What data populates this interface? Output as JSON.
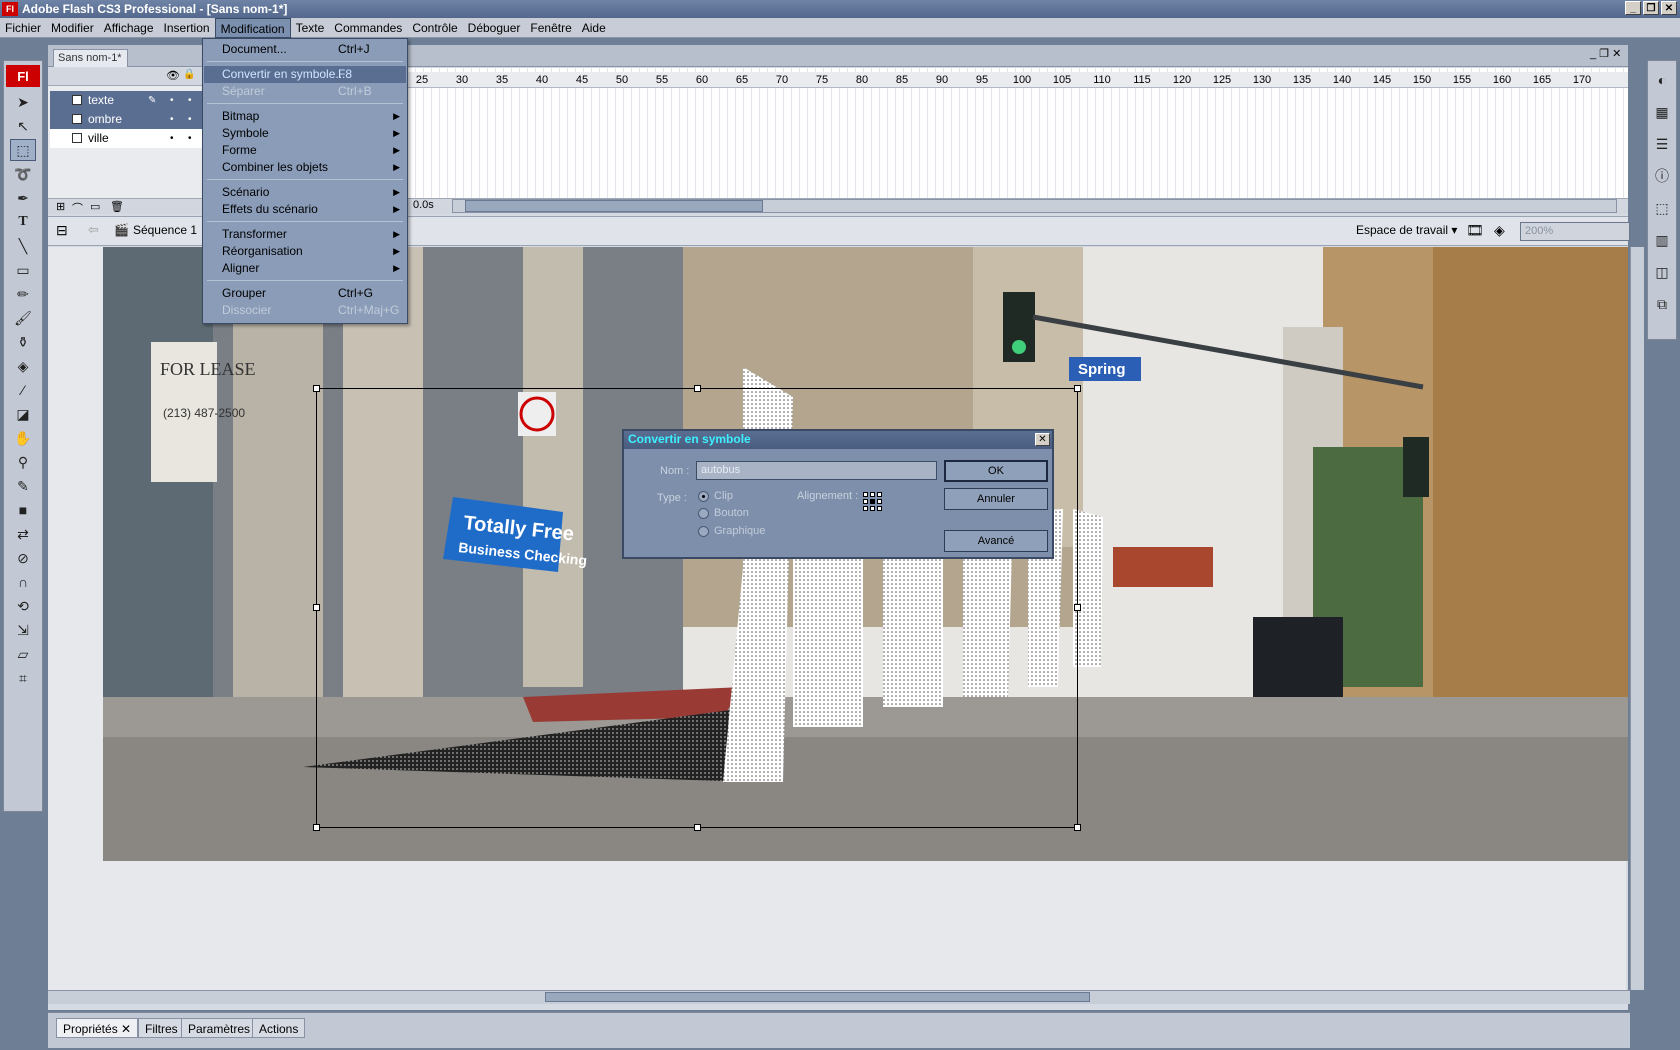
{
  "titlebar": {
    "title": "Adobe Flash CS3 Professional - [Sans nom-1*]",
    "logo": "Fl"
  },
  "menubar": {
    "items": [
      "Fichier",
      "Modifier",
      "Affichage",
      "Insertion",
      "Modification",
      "Texte",
      "Commandes",
      "Contrôle",
      "Déboguer",
      "Fenêtre",
      "Aide"
    ],
    "active": "Modification"
  },
  "document": {
    "tab": "Sans nom-1*"
  },
  "timeline": {
    "layers": [
      {
        "name": "texte",
        "highlighted": true
      },
      {
        "name": "ombre",
        "highlighted": true
      },
      {
        "name": "ville",
        "highlighted": false
      }
    ],
    "ruler": [
      "25",
      "30",
      "35",
      "40",
      "45",
      "50",
      "55",
      "60",
      "65",
      "70",
      "75",
      "80",
      "85",
      "90",
      "95",
      "100",
      "105",
      "110",
      "115",
      "120",
      "125",
      "130",
      "135",
      "140",
      "145",
      "150",
      "155",
      "160",
      "165",
      "170"
    ],
    "time": "0.0s"
  },
  "editbar": {
    "scene": "Séquence 1",
    "workspace": "Espace de travail ▾",
    "zoom": "200%"
  },
  "dropdown": {
    "items": [
      {
        "label": "Document...",
        "shortcut": "Ctrl+J",
        "arrow": "",
        "state": ""
      },
      {
        "label": "Convertir en symbole...",
        "shortcut": "F8",
        "arrow": "",
        "state": "hot"
      },
      {
        "label": "Séparer",
        "shortcut": "Ctrl+B",
        "arrow": "",
        "state": "dis"
      },
      {
        "label": "Bitmap",
        "shortcut": "",
        "arrow": "▶",
        "state": ""
      },
      {
        "label": "Symbole",
        "shortcut": "",
        "arrow": "▶",
        "state": ""
      },
      {
        "label": "Forme",
        "shortcut": "",
        "arrow": "▶",
        "state": ""
      },
      {
        "label": "Combiner les objets",
        "shortcut": "",
        "arrow": "▶",
        "state": ""
      },
      {
        "label": "Scénario",
        "shortcut": "",
        "arrow": "▶",
        "state": ""
      },
      {
        "label": "Effets du scénario",
        "shortcut": "",
        "arrow": "▶",
        "state": ""
      },
      {
        "label": "Transformer",
        "shortcut": "",
        "arrow": "▶",
        "state": ""
      },
      {
        "label": "Réorganisation",
        "shortcut": "",
        "arrow": "▶",
        "state": ""
      },
      {
        "label": "Aligner",
        "shortcut": "",
        "arrow": "▶",
        "state": ""
      },
      {
        "label": "Grouper",
        "shortcut": "Ctrl+G",
        "arrow": "",
        "state": ""
      },
      {
        "label": "Dissocier",
        "shortcut": "Ctrl+Maj+G",
        "arrow": "",
        "state": "dis"
      }
    ]
  },
  "dialog": {
    "title": "Convertir en symbole",
    "name_label": "Nom :",
    "name_value": "autobus",
    "type_label": "Type :",
    "types": [
      "Clip",
      "Bouton",
      "Graphique"
    ],
    "selected_type": "Clip",
    "align_label": "Alignement :",
    "ok": "OK",
    "cancel": "Annuler",
    "advanced": "Avancé"
  },
  "stage_text": {
    "for_lease": "FOR LEASE",
    "phone": "(213) 487-2500",
    "banner1": "Totally Free",
    "banner2": "Business Checking",
    "street": "Spring",
    "word": "AUTOBUS"
  },
  "properties": {
    "tabs": [
      "Propriétés",
      "Filtres",
      "Paramètres",
      "Actions"
    ]
  },
  "colors": {
    "accent": "#5a6e92",
    "dialog_title_text": "#3cf0ff",
    "flash_red": "#cc0000"
  }
}
